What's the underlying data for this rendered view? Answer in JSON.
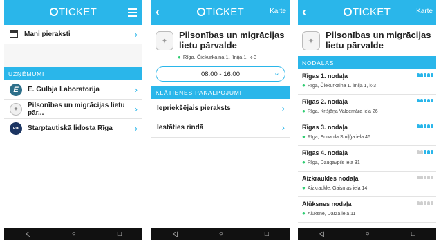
{
  "colors": {
    "accent": "#2ab6ea",
    "pin": "#2ecc71",
    "nav": "#111111",
    "person_on": "#2ab6ea",
    "person_off": "#cfcfcf"
  },
  "screen1": {
    "logo": "TICKET",
    "menu_icon": "hamburger-icon",
    "my_records": "Mani pieraksti",
    "section": "UZŅĒMUMI",
    "companies": [
      {
        "name": "E. Gulbja Laboratorija",
        "icon": "E",
        "icon_name": "e-gulbis-logo"
      },
      {
        "name": "Pilsonības un migrācijas lietu pār...",
        "icon": "✦",
        "icon_name": "coat-of-arms-logo"
      },
      {
        "name": "Starptautiskā lidosta Rīga",
        "icon": "RIX",
        "icon_name": "rix-logo"
      }
    ]
  },
  "screen2": {
    "logo": "TICKET",
    "karte": "Karte",
    "org_name": "Pilsonības un migrācijas lietu pārvalde",
    "address": "Rīga, Čiekurkalna 1. līnija 1, k-3",
    "hours": "08:00 - 16:00",
    "section": "KLĀTIENES PAKALPOJUMI",
    "services": [
      "Iepriekšējais pieraksts",
      "Iestāties rindā"
    ]
  },
  "screen3": {
    "logo": "TICKET",
    "karte": "Karte",
    "org_name": "Pilsonības un migrācijas lietu pārvalde",
    "section": "NODAĻAS",
    "departments": [
      {
        "name": "Rīgas 1. nodaļa",
        "address": "Rīga, Čiekurkalna 1. līnija 1, k-3",
        "load": 5
      },
      {
        "name": "Rīgas 2. nodaļa",
        "address": "Rīga, Krišjāņa Valdemāra iela 26",
        "load": 5
      },
      {
        "name": "Rīgas 3. nodaļa",
        "address": "Rīga, Eduarda Smiļģa iela 46",
        "load": 5
      },
      {
        "name": "Rīgas 4. nodaļa",
        "address": "Rīga, Daugavpils iela 31",
        "load": 3
      },
      {
        "name": "Aizkraukles nodaļa",
        "address": "Aizkraukle, Gaismas iela 14",
        "load": 0
      },
      {
        "name": "Alūksnes nodaļa",
        "address": "Alūksne, Dārza iela 11",
        "load": 0
      }
    ]
  },
  "nav": {
    "back": "◁",
    "home": "○",
    "recent": "□"
  }
}
